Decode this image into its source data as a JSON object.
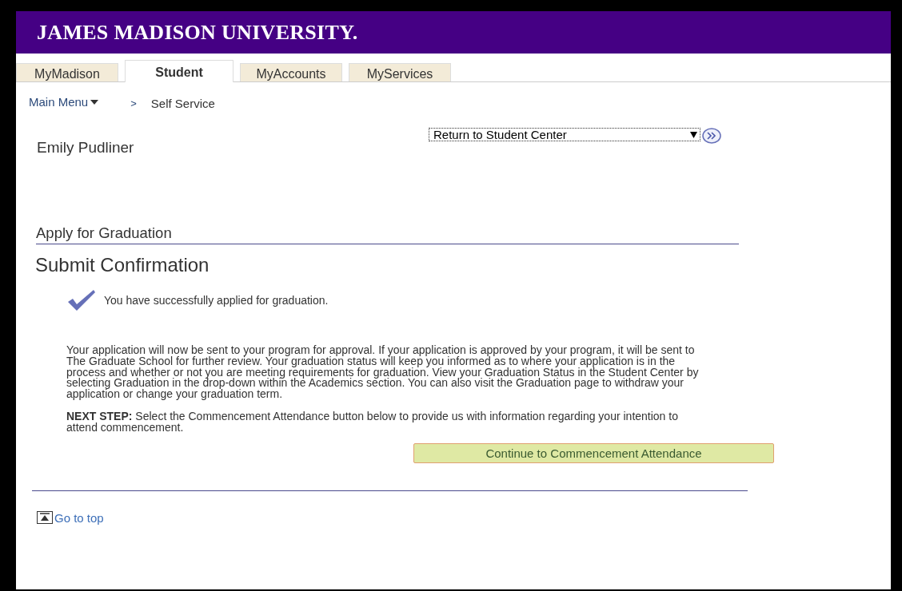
{
  "header": {
    "title": "JAMES MADISON UNIVERSITY."
  },
  "tabs": [
    {
      "label": "MyMadison",
      "selected": false
    },
    {
      "label": "Student",
      "selected": true
    },
    {
      "label": "MyAccounts",
      "selected": false
    },
    {
      "label": "MyServices",
      "selected": false
    }
  ],
  "breadcrumb": {
    "menu": "Main Menu",
    "separator": ">",
    "current": "Self Service"
  },
  "student_name": "Emily Pudliner",
  "navigation": {
    "value": "Return to Student Center"
  },
  "page": {
    "heading": "Apply for Graduation",
    "subheading": "Submit Confirmation"
  },
  "confirmation": "You have successfully applied for graduation.",
  "paragraphs": [
    "Your application will now be sent to your program for approval. If your application is approved by your program, it will be sent to The Graduate School for further review. Your graduation status will keep you informed as to where your application is in the process and whether or not you are meeting requirements for graduation. View your Graduation Status in the Student Center by selecting Graduation in the drop-down within the Academics section. You can also visit the Graduation page to withdraw your application or change your graduation term.",
    "**NEXT STEP:** Select the Commencement Attendance button below to provide us with information regarding your intention to attend commencement."
  ],
  "continue_button": "Continue to Commencement Attendance",
  "go_to_top": "Go to top"
}
